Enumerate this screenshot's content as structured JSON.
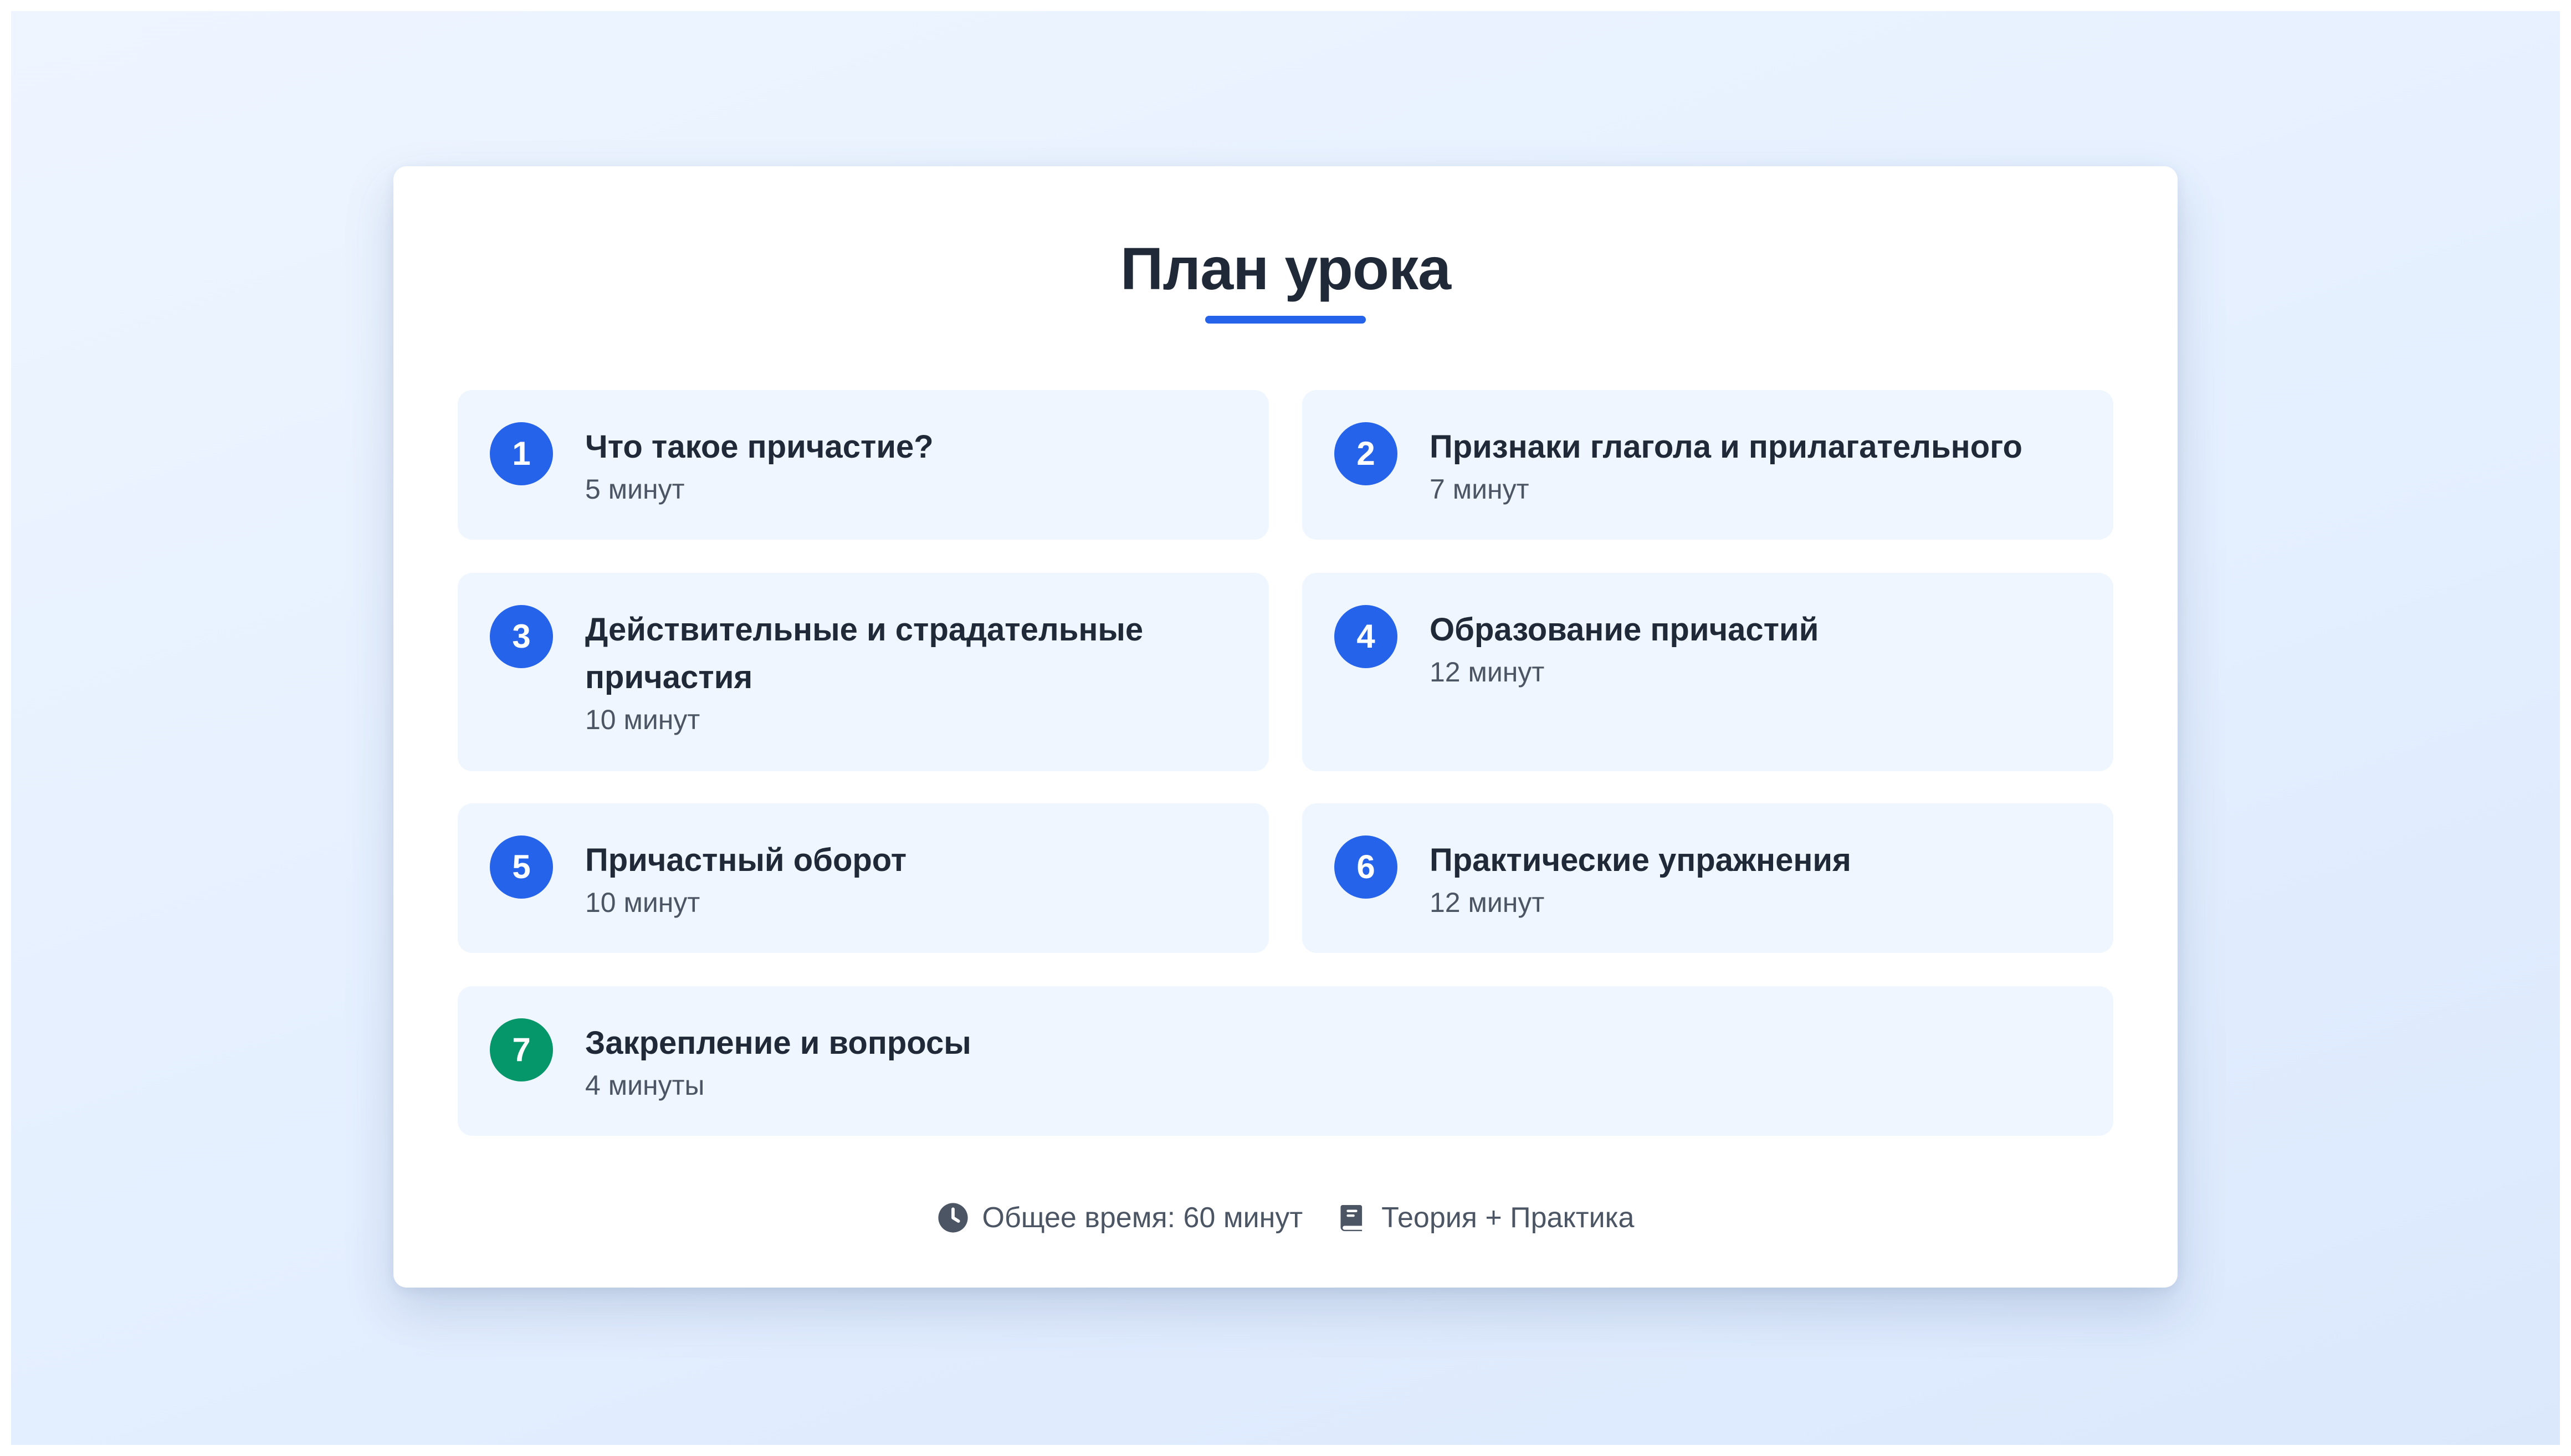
{
  "title": "План урока",
  "accent_color": "#2563eb",
  "final_color": "#059669",
  "items": [
    {
      "number": "1",
      "title": "Что такое причастие?",
      "duration": "5 минут"
    },
    {
      "number": "2",
      "title": "Признаки глагола и прилагательного",
      "duration": "7 минут"
    },
    {
      "number": "3",
      "title": "Действительные и страдательные причастия",
      "duration": "10 минут"
    },
    {
      "number": "4",
      "title": "Образование причастий",
      "duration": "12 минут"
    },
    {
      "number": "5",
      "title": "Причастный оборот",
      "duration": "10 минут"
    },
    {
      "number": "6",
      "title": "Практические упражнения",
      "duration": "12 минут"
    },
    {
      "number": "7",
      "title": "Закрепление и вопросы",
      "duration": "4 минуты"
    }
  ],
  "footer": {
    "clock_icon": "clock-icon",
    "total_time": "Общее время: 60 минут",
    "book_icon": "book-icon",
    "format": "Теория + Практика"
  }
}
